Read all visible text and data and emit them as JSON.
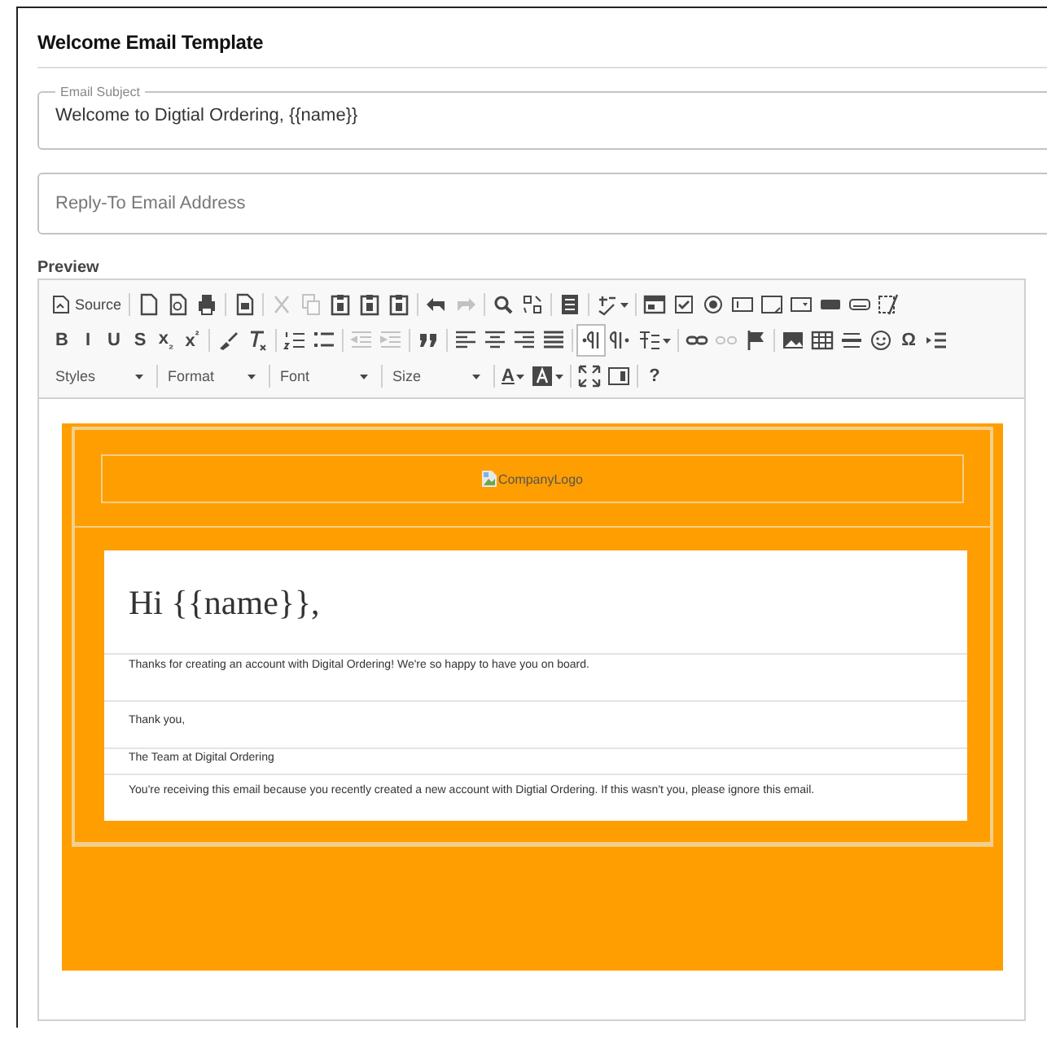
{
  "panel": {
    "title": "Welcome Email Template"
  },
  "fields": [
    {
      "kind": "outlined",
      "label": "Email Subject",
      "value": "Welcome to Digtial Ordering, {{name}}"
    },
    {
      "kind": "plain",
      "placeholder": "Reply-To Email Address"
    }
  ],
  "preview": {
    "label": "Preview",
    "toolbar": [
      [
        [
          {
            "kind": "source",
            "label": "Source"
          }
        ],
        [
          {
            "kind": "icon",
            "disabled": false,
            "pressed": false
          },
          {
            "kind": "icon",
            "disabled": false,
            "pressed": false
          },
          {
            "kind": "icon",
            "disabled": false,
            "pressed": false
          }
        ],
        [
          {
            "kind": "icon",
            "disabled": false,
            "pressed": false
          }
        ],
        [
          {
            "kind": "icon",
            "disabled": true,
            "pressed": false
          },
          {
            "kind": "icon",
            "disabled": true,
            "pressed": false
          },
          {
            "kind": "icon",
            "disabled": false,
            "pressed": false
          },
          {
            "kind": "icon",
            "disabled": false,
            "pressed": false
          },
          {
            "kind": "icon",
            "disabled": false,
            "pressed": false
          }
        ],
        [
          {
            "kind": "icon",
            "disabled": false,
            "pressed": false
          },
          {
            "kind": "icon",
            "disabled": true,
            "pressed": false
          }
        ],
        [
          {
            "kind": "icon",
            "disabled": false,
            "pressed": false
          },
          {
            "kind": "icon",
            "disabled": false,
            "pressed": false
          }
        ],
        [
          {
            "kind": "icon",
            "disabled": false,
            "pressed": false
          }
        ],
        [
          {
            "kind": "icon",
            "disabled": false,
            "pressed": false
          }
        ],
        [
          {
            "kind": "icon",
            "disabled": false,
            "pressed": false
          },
          {
            "kind": "icon",
            "disabled": false,
            "pressed": false
          },
          {
            "kind": "icon",
            "disabled": false,
            "pressed": false
          },
          {
            "kind": "icon",
            "disabled": false,
            "pressed": false
          },
          {
            "kind": "icon",
            "disabled": false,
            "pressed": false
          },
          {
            "kind": "icon",
            "disabled": false,
            "pressed": false
          },
          {
            "kind": "icon",
            "disabled": false,
            "pressed": false
          },
          {
            "kind": "icon",
            "disabled": false,
            "pressed": false
          },
          {
            "kind": "icon",
            "disabled": false,
            "pressed": false
          }
        ]
      ],
      [
        [
          {
            "kind": "text",
            "label": "B",
            "disabled": false,
            "pressed": false
          },
          {
            "kind": "text",
            "label": "I",
            "disabled": false,
            "pressed": false
          },
          {
            "kind": "text",
            "label": "U",
            "disabled": false,
            "pressed": false
          },
          {
            "kind": "text",
            "label": "S",
            "disabled": false,
            "pressed": false
          },
          {
            "kind": "text",
            "label": "x$_{₂}$",
            "disabled": false,
            "pressed": false
          },
          {
            "kind": "text",
            "label": "x$^{²}$",
            "disabled": false,
            "pressed": false
          }
        ],
        [
          {
            "kind": "icon",
            "disabled": false,
            "pressed": false
          },
          {
            "kind": "icon",
            "disabled": false,
            "pressed": false
          }
        ],
        [
          {
            "kind": "icon",
            "disabled": false,
            "pressed": false
          },
          {
            "kind": "icon",
            "disabled": false,
            "pressed": false
          }
        ],
        [
          {
            "kind": "icon",
            "disabled": true,
            "pressed": false
          },
          {
            "kind": "icon",
            "disabled": true,
            "pressed": false
          }
        ],
        [
          {
            "kind": "icon",
            "disabled": false,
            "pressed": false
          }
        ],
        [
          {
            "kind": "icon",
            "disabled": false,
            "pressed": false
          },
          {
            "kind": "icon",
            "disabled": false,
            "pressed": false
          },
          {
            "kind": "icon",
            "disabled": false,
            "pressed": false
          },
          {
            "kind": "icon",
            "disabled": false,
            "pressed": false
          }
        ],
        [
          {
            "kind": "icon",
            "disabled": false,
            "pressed": true
          },
          {
            "kind": "icon",
            "disabled": false,
            "pressed": false
          },
          {
            "kind": "icon",
            "disabled": false,
            "pressed": false
          }
        ],
        [
          {
            "kind": "icon",
            "disabled": false,
            "pressed": false
          },
          {
            "kind": "icon",
            "disabled": true,
            "pressed": false
          },
          {
            "kind": "icon",
            "disabled": false,
            "pressed": false
          }
        ],
        [
          {
            "kind": "icon",
            "disabled": false,
            "pressed": false
          },
          {
            "kind": "icon",
            "disabled": false,
            "pressed": false
          },
          {
            "kind": "icon",
            "disabled": false,
            "pressed": false
          },
          {
            "kind": "icon",
            "disabled": false,
            "pressed": false
          },
          {
            "kind": "text",
            "label": "Ω",
            "disabled": false,
            "pressed": false
          },
          {
            "kind": "icon",
            "disabled": false,
            "pressed": false
          }
        ]
      ],
      [
        [
          {
            "kind": "combo",
            "label": "Styles"
          }
        ],
        [
          {
            "kind": "combo",
            "label": "Format"
          }
        ],
        [
          {
            "kind": "combo",
            "label": "Font"
          }
        ],
        [
          {
            "kind": "combo",
            "label": "Size"
          }
        ],
        [
          {
            "kind": "color",
            "label": "A",
            "disabled": false,
            "pressed": false
          },
          {
            "kind": "icon",
            "disabled": false,
            "pressed": false
          }
        ],
        [
          {
            "kind": "icon",
            "disabled": false,
            "pressed": false
          },
          {
            "kind": "icon",
            "disabled": false,
            "pressed": false
          }
        ],
        [
          {
            "kind": "text",
            "label": "?",
            "disabled": false,
            "pressed": false
          }
        ]
      ]
    ],
    "email": {
      "logo_alt": "CompanyLogo",
      "greeting": "Hi {{name}},",
      "rows": [
        {
          "kind": "body",
          "text": "Thanks for creating an account with Digital Ordering! We're so happy to have you on board."
        },
        {
          "kind": "body",
          "text": "Thank you,"
        },
        {
          "kind": "signature",
          "text": "The Team at Digital Ordering"
        },
        {
          "kind": "footer",
          "text": "You're receiving this email because you recently created a new account with Digtial Ordering. If this wasn't you, please ignore this email."
        }
      ]
    }
  }
}
